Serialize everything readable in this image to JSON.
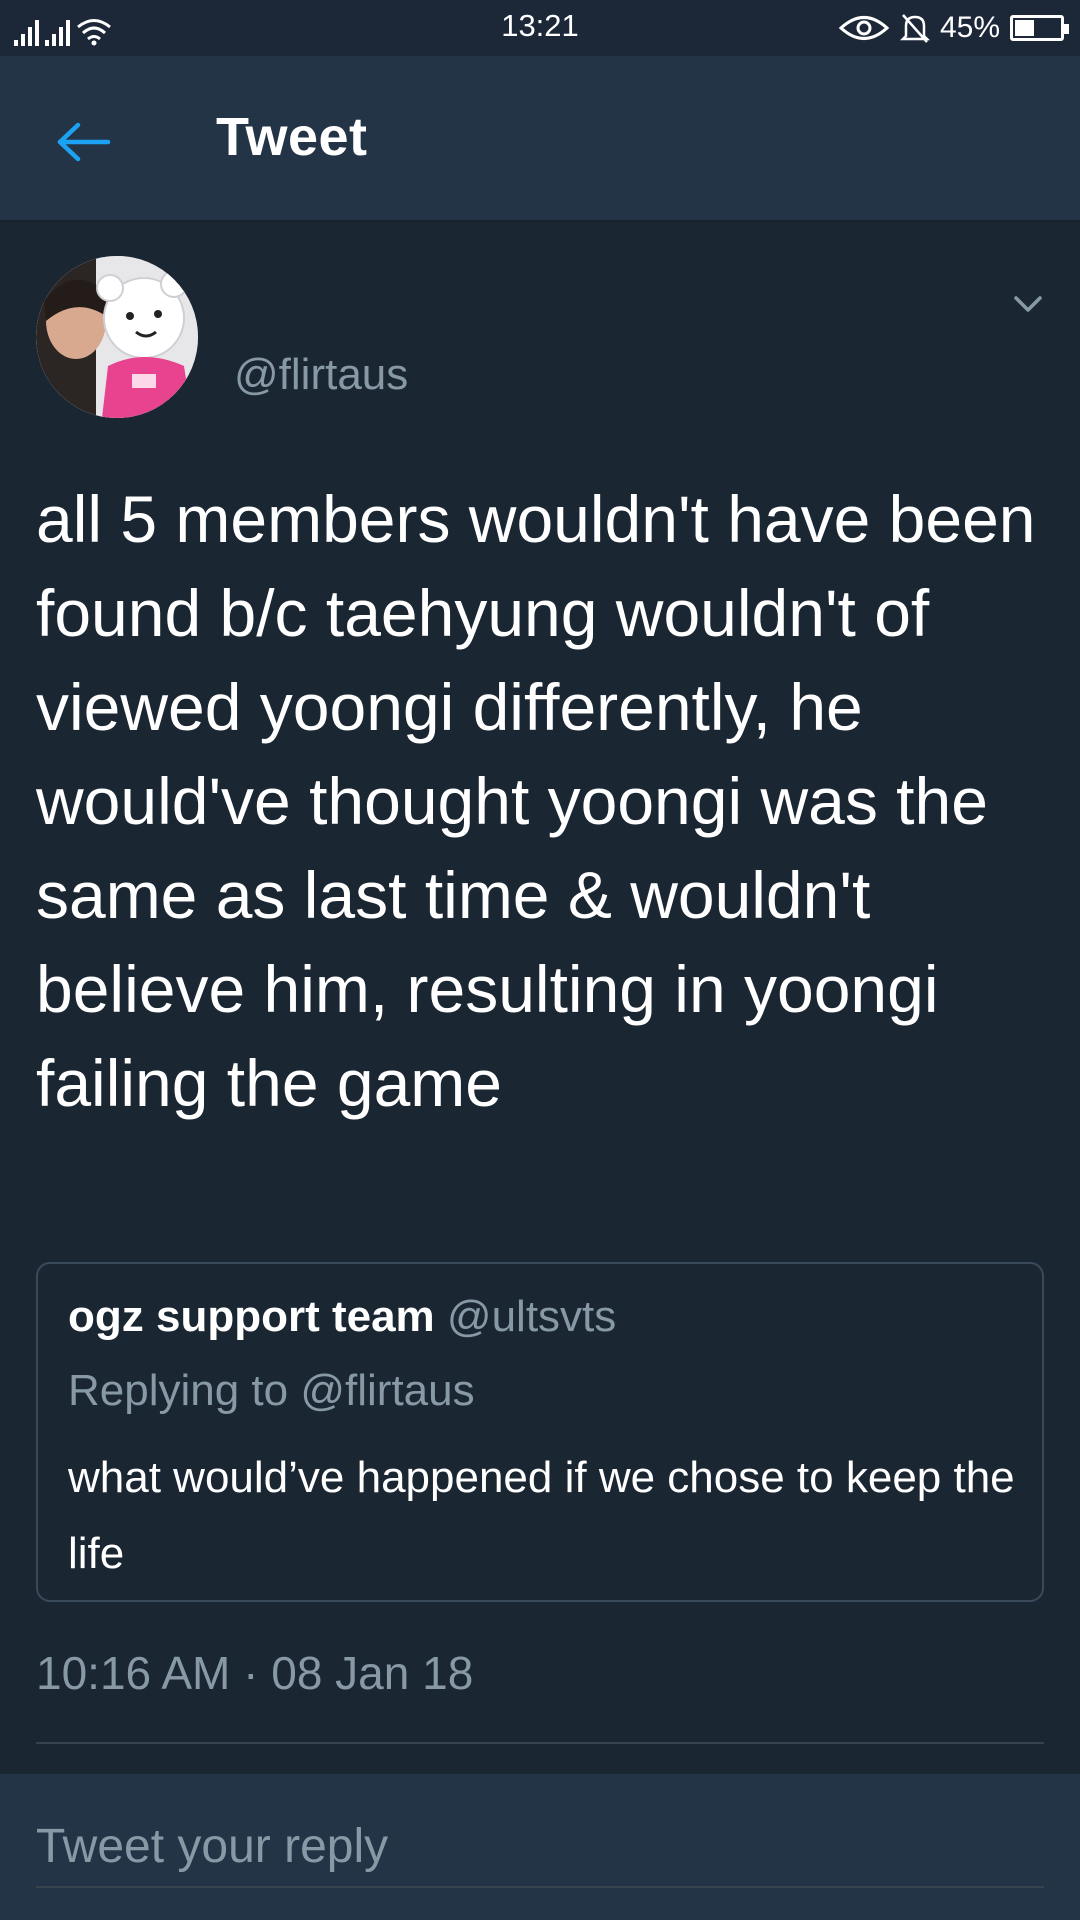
{
  "status_bar": {
    "time": "13:21",
    "battery": "45%",
    "battery_level": 0.45,
    "icons": [
      "signal-icon",
      "signal-icon",
      "wifi-icon",
      "eye-icon",
      "bell-off-icon",
      "battery-icon"
    ]
  },
  "header": {
    "title": "Tweet",
    "back_icon": "arrow-left-icon"
  },
  "tweet": {
    "handle": "@flirtaus",
    "text": "all 5 members wouldn't have been found b/c taehyung wouldn't of viewed yoongi differently, he would've thought yoongi was the same as last time & wouldn't believe him, resulting in yoongi failing the game",
    "timestamp": "10:16 AM · 08 Jan 18"
  },
  "quoted_tweet": {
    "name": "ogz support team",
    "handle": "@ultsvts",
    "replying_to": "Replying to @flirtaus",
    "text": "what would’ve happened if we chose to keep the life"
  },
  "reply": {
    "placeholder": "Tweet your reply"
  },
  "colors": {
    "background": "#1b2633",
    "header": "#243447",
    "accent": "#1da1f2",
    "secondary_text": "#8899a6"
  }
}
